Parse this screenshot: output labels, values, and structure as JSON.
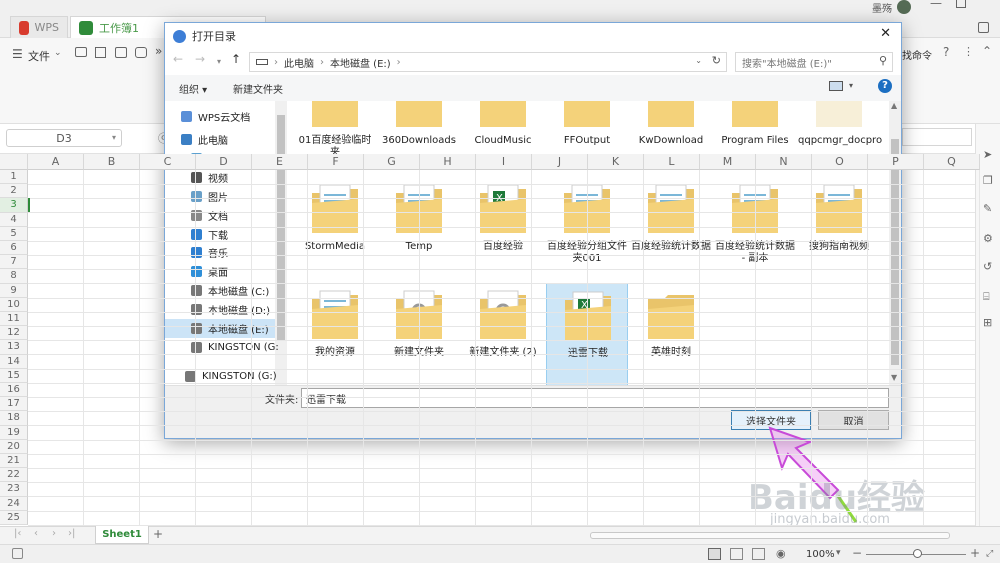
{
  "app": {
    "tabs": [
      {
        "label": "WPS"
      },
      {
        "label": "工作簿1"
      }
    ],
    "user": "墨殇",
    "toolbar": {
      "file_menu": "文件",
      "more": "»",
      "find_command": "找命令",
      "help": "?"
    },
    "name_box": "D3",
    "columns": [
      "A",
      "B",
      "C",
      "D",
      "E",
      "F",
      "G",
      "H",
      "I",
      "J",
      "K",
      "L",
      "M",
      "N",
      "O",
      "P",
      "Q"
    ],
    "rows": [
      "1",
      "2",
      "3",
      "4",
      "5",
      "6",
      "7",
      "8",
      "9",
      "10",
      "11",
      "12",
      "13",
      "14",
      "15",
      "16",
      "17",
      "18",
      "19",
      "20",
      "21",
      "22",
      "23",
      "24",
      "25"
    ],
    "sheet_tab": "Sheet1",
    "zoom": "100%",
    "colors": {
      "wps_red": "#d83b2e",
      "sheet_green": "#2f8b3a",
      "accent_blue": "#0078d7"
    }
  },
  "dialog": {
    "title": "打开目录",
    "breadcrumb": [
      "此电脑",
      "本地磁盘 (E:)"
    ],
    "search_placeholder": "搜索\"本地磁盘 (E:)\"",
    "commands": {
      "organize": "组织 ▾",
      "new_folder": "新建文件夹"
    },
    "nav": [
      {
        "label": "WPS云文档",
        "icon": "cloud-icon"
      },
      {
        "label": "此电脑",
        "icon": "computer-icon"
      },
      {
        "label": "3D 对象",
        "icon": "3d-objects-icon"
      },
      {
        "label": "视频",
        "icon": "video-icon"
      },
      {
        "label": "图片",
        "icon": "pictures-icon"
      },
      {
        "label": "文档",
        "icon": "documents-icon"
      },
      {
        "label": "下载",
        "icon": "download-icon"
      },
      {
        "label": "音乐",
        "icon": "music-icon"
      },
      {
        "label": "桌面",
        "icon": "desktop-icon"
      },
      {
        "label": "本地磁盘 (C:)",
        "icon": "drive-icon"
      },
      {
        "label": "本地磁盘 (D:)",
        "icon": "drive-icon"
      },
      {
        "label": "本地磁盘 (E:)",
        "icon": "drive-icon",
        "selected": true
      },
      {
        "label": "KINGSTON (G:",
        "icon": "usb-drive-icon"
      },
      {
        "label": "KINGSTON (G:)",
        "icon": "usb-drive-icon"
      }
    ],
    "files": [
      {
        "label": "01百度经验临时夹",
        "kind": "folder-docs"
      },
      {
        "label": "360Downloads",
        "kind": "folder-docs"
      },
      {
        "label": "CloudMusic",
        "kind": "folder-image"
      },
      {
        "label": "FFOutput",
        "kind": "folder"
      },
      {
        "label": "KwDownload",
        "kind": "folder-docs"
      },
      {
        "label": "Program Files",
        "kind": "folder-docs"
      },
      {
        "label": "qqpcmgr_docpro",
        "kind": "folder-faded"
      },
      {
        "label": "StormMedia",
        "kind": "folder-docs"
      },
      {
        "label": "Temp",
        "kind": "folder-docs"
      },
      {
        "label": "百度经验",
        "kind": "folder-excel"
      },
      {
        "label": "百度经验分组文件夹001",
        "kind": "folder-docs"
      },
      {
        "label": "百度经验统计数据",
        "kind": "folder-docs"
      },
      {
        "label": "百度经验统计数据 - 副本",
        "kind": "folder-docs"
      },
      {
        "label": "搜狗指南视频",
        "kind": "folder-docs"
      },
      {
        "label": "我的资源",
        "kind": "folder-docs"
      },
      {
        "label": "新建文件夹",
        "kind": "folder-gear"
      },
      {
        "label": "新建文件夹 (2)",
        "kind": "folder-gear"
      },
      {
        "label": "迅雷下载",
        "kind": "folder-excel",
        "selected": true
      },
      {
        "label": "英雄时刻",
        "kind": "folder"
      }
    ],
    "folder_label": "文件夹:",
    "folder_value": "迅雷下载",
    "buttons": {
      "select": "选择文件夹",
      "cancel": "取消"
    }
  },
  "watermark": {
    "brand": "Baidu经验",
    "url": "jingyan.baidu.com"
  }
}
